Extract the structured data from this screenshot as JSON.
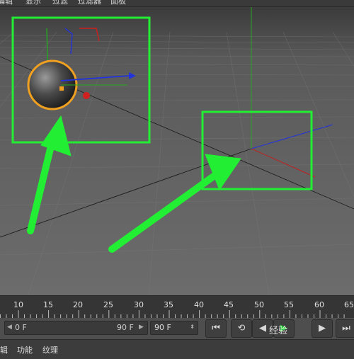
{
  "menubar": {
    "items": [
      "编辑",
      "显示",
      "过滤",
      "过滤器",
      "面板"
    ]
  },
  "timeline": {
    "ticks": [
      "10",
      "15",
      "20",
      "25",
      "30",
      "35",
      "40",
      "45",
      "50",
      "55",
      "60",
      "65"
    ]
  },
  "controls": {
    "range_start": "0 F",
    "range_end": "90 F",
    "end_frame_field": "90 F",
    "buttons": {
      "first": "⏮",
      "loop": "⟲",
      "prev": "◀",
      "play": "▶",
      "next": "▶",
      "last": "⏭"
    }
  },
  "bottombar": {
    "items": [
      "辑",
      "功能",
      "纹理"
    ]
  },
  "watermark": "经验",
  "colors": {
    "highlight": "#22ee33",
    "selection": "#f0a020",
    "axis_x": "#d02020",
    "axis_y": "#22aa22",
    "axis_z": "#2233dd"
  }
}
